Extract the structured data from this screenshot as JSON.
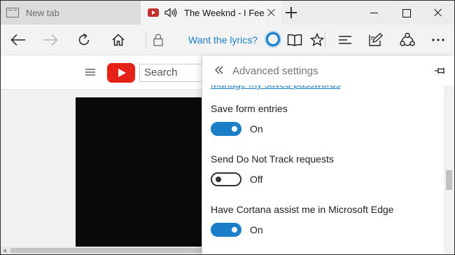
{
  "tabs": [
    {
      "label": "New tab",
      "icon": "new-tab-page-icon",
      "active": false
    },
    {
      "label": "The Weeknd - I Fee",
      "icon": "youtube-favicon-icon",
      "audio": "speaker-icon",
      "active": true
    }
  ],
  "window": {
    "controls": [
      "minimize",
      "maximize",
      "close"
    ]
  },
  "navbar": {
    "lyrics_prompt": "Want the lyrics?",
    "icons": [
      "back-icon",
      "forward-icon",
      "refresh-icon",
      "home-icon",
      "lock-icon",
      "cortana-icon",
      "reading-view-icon",
      "favorite-star-icon",
      "hub-icon",
      "web-note-icon",
      "share-icon",
      "more-icon"
    ]
  },
  "youtube": {
    "search_placeholder": "Search"
  },
  "settings": {
    "title": "Advanced settings",
    "manage_link": "Manage my saved passwords",
    "items": [
      {
        "label": "Save form entries",
        "state": "On",
        "enabled": true
      },
      {
        "label": "Send Do Not Track requests",
        "state": "Off",
        "enabled": false
      },
      {
        "label": "Have Cortana assist me in Microsoft Edge",
        "state": "On",
        "enabled": true
      }
    ]
  },
  "colors": {
    "accent": "#1a7ec9",
    "youtube_red": "#e62117"
  }
}
